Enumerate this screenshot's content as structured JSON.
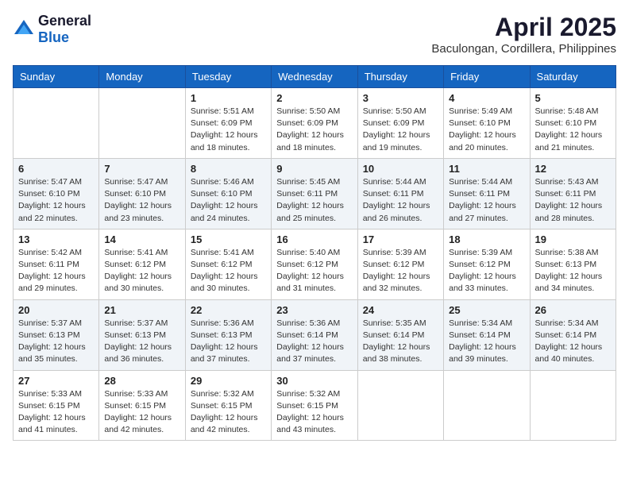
{
  "logo": {
    "general": "General",
    "blue": "Blue"
  },
  "title": "April 2025",
  "subtitle": "Baculongan, Cordillera, Philippines",
  "weekdays": [
    "Sunday",
    "Monday",
    "Tuesday",
    "Wednesday",
    "Thursday",
    "Friday",
    "Saturday"
  ],
  "weeks": [
    [
      {
        "day": "",
        "content": ""
      },
      {
        "day": "",
        "content": ""
      },
      {
        "day": "1",
        "content": "Sunrise: 5:51 AM\nSunset: 6:09 PM\nDaylight: 12 hours and 18 minutes."
      },
      {
        "day": "2",
        "content": "Sunrise: 5:50 AM\nSunset: 6:09 PM\nDaylight: 12 hours and 18 minutes."
      },
      {
        "day": "3",
        "content": "Sunrise: 5:50 AM\nSunset: 6:09 PM\nDaylight: 12 hours and 19 minutes."
      },
      {
        "day": "4",
        "content": "Sunrise: 5:49 AM\nSunset: 6:10 PM\nDaylight: 12 hours and 20 minutes."
      },
      {
        "day": "5",
        "content": "Sunrise: 5:48 AM\nSunset: 6:10 PM\nDaylight: 12 hours and 21 minutes."
      }
    ],
    [
      {
        "day": "6",
        "content": "Sunrise: 5:47 AM\nSunset: 6:10 PM\nDaylight: 12 hours and 22 minutes."
      },
      {
        "day": "7",
        "content": "Sunrise: 5:47 AM\nSunset: 6:10 PM\nDaylight: 12 hours and 23 minutes."
      },
      {
        "day": "8",
        "content": "Sunrise: 5:46 AM\nSunset: 6:10 PM\nDaylight: 12 hours and 24 minutes."
      },
      {
        "day": "9",
        "content": "Sunrise: 5:45 AM\nSunset: 6:11 PM\nDaylight: 12 hours and 25 minutes."
      },
      {
        "day": "10",
        "content": "Sunrise: 5:44 AM\nSunset: 6:11 PM\nDaylight: 12 hours and 26 minutes."
      },
      {
        "day": "11",
        "content": "Sunrise: 5:44 AM\nSunset: 6:11 PM\nDaylight: 12 hours and 27 minutes."
      },
      {
        "day": "12",
        "content": "Sunrise: 5:43 AM\nSunset: 6:11 PM\nDaylight: 12 hours and 28 minutes."
      }
    ],
    [
      {
        "day": "13",
        "content": "Sunrise: 5:42 AM\nSunset: 6:11 PM\nDaylight: 12 hours and 29 minutes."
      },
      {
        "day": "14",
        "content": "Sunrise: 5:41 AM\nSunset: 6:12 PM\nDaylight: 12 hours and 30 minutes."
      },
      {
        "day": "15",
        "content": "Sunrise: 5:41 AM\nSunset: 6:12 PM\nDaylight: 12 hours and 30 minutes."
      },
      {
        "day": "16",
        "content": "Sunrise: 5:40 AM\nSunset: 6:12 PM\nDaylight: 12 hours and 31 minutes."
      },
      {
        "day": "17",
        "content": "Sunrise: 5:39 AM\nSunset: 6:12 PM\nDaylight: 12 hours and 32 minutes."
      },
      {
        "day": "18",
        "content": "Sunrise: 5:39 AM\nSunset: 6:12 PM\nDaylight: 12 hours and 33 minutes."
      },
      {
        "day": "19",
        "content": "Sunrise: 5:38 AM\nSunset: 6:13 PM\nDaylight: 12 hours and 34 minutes."
      }
    ],
    [
      {
        "day": "20",
        "content": "Sunrise: 5:37 AM\nSunset: 6:13 PM\nDaylight: 12 hours and 35 minutes."
      },
      {
        "day": "21",
        "content": "Sunrise: 5:37 AM\nSunset: 6:13 PM\nDaylight: 12 hours and 36 minutes."
      },
      {
        "day": "22",
        "content": "Sunrise: 5:36 AM\nSunset: 6:13 PM\nDaylight: 12 hours and 37 minutes."
      },
      {
        "day": "23",
        "content": "Sunrise: 5:36 AM\nSunset: 6:14 PM\nDaylight: 12 hours and 37 minutes."
      },
      {
        "day": "24",
        "content": "Sunrise: 5:35 AM\nSunset: 6:14 PM\nDaylight: 12 hours and 38 minutes."
      },
      {
        "day": "25",
        "content": "Sunrise: 5:34 AM\nSunset: 6:14 PM\nDaylight: 12 hours and 39 minutes."
      },
      {
        "day": "26",
        "content": "Sunrise: 5:34 AM\nSunset: 6:14 PM\nDaylight: 12 hours and 40 minutes."
      }
    ],
    [
      {
        "day": "27",
        "content": "Sunrise: 5:33 AM\nSunset: 6:15 PM\nDaylight: 12 hours and 41 minutes."
      },
      {
        "day": "28",
        "content": "Sunrise: 5:33 AM\nSunset: 6:15 PM\nDaylight: 12 hours and 42 minutes."
      },
      {
        "day": "29",
        "content": "Sunrise: 5:32 AM\nSunset: 6:15 PM\nDaylight: 12 hours and 42 minutes."
      },
      {
        "day": "30",
        "content": "Sunrise: 5:32 AM\nSunset: 6:15 PM\nDaylight: 12 hours and 43 minutes."
      },
      {
        "day": "",
        "content": ""
      },
      {
        "day": "",
        "content": ""
      },
      {
        "day": "",
        "content": ""
      }
    ]
  ]
}
